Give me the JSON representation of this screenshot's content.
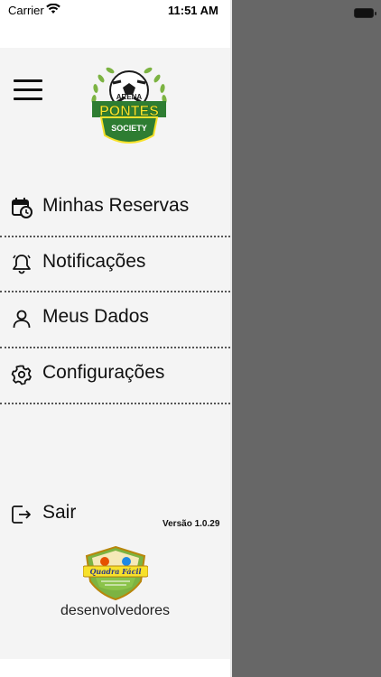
{
  "status_bar": {
    "carrier": "Carrier",
    "time": "11:51 AM"
  },
  "header": {
    "logo": {
      "line1": "ARENA",
      "line2": "PONTES",
      "line3": "SOCIETY"
    }
  },
  "menu": {
    "items": [
      {
        "label": "Minhas Reservas",
        "icon": "calendar-clock-icon"
      },
      {
        "label": "Notificações",
        "icon": "bell-icon"
      },
      {
        "label": "Meus Dados",
        "icon": "user-icon"
      },
      {
        "label": "Configurações",
        "icon": "gear-icon"
      }
    ]
  },
  "footer": {
    "logout_label": "Sair",
    "version": "Versão 1.0.29",
    "dev_logo_text": "Quadra Fácil",
    "dev_label": "desenvolvedores"
  },
  "colors": {
    "panel": "#f4f4f4",
    "overlay": "#676767",
    "logo_green": "#2e7d32",
    "logo_yellow": "#f7e12b"
  }
}
